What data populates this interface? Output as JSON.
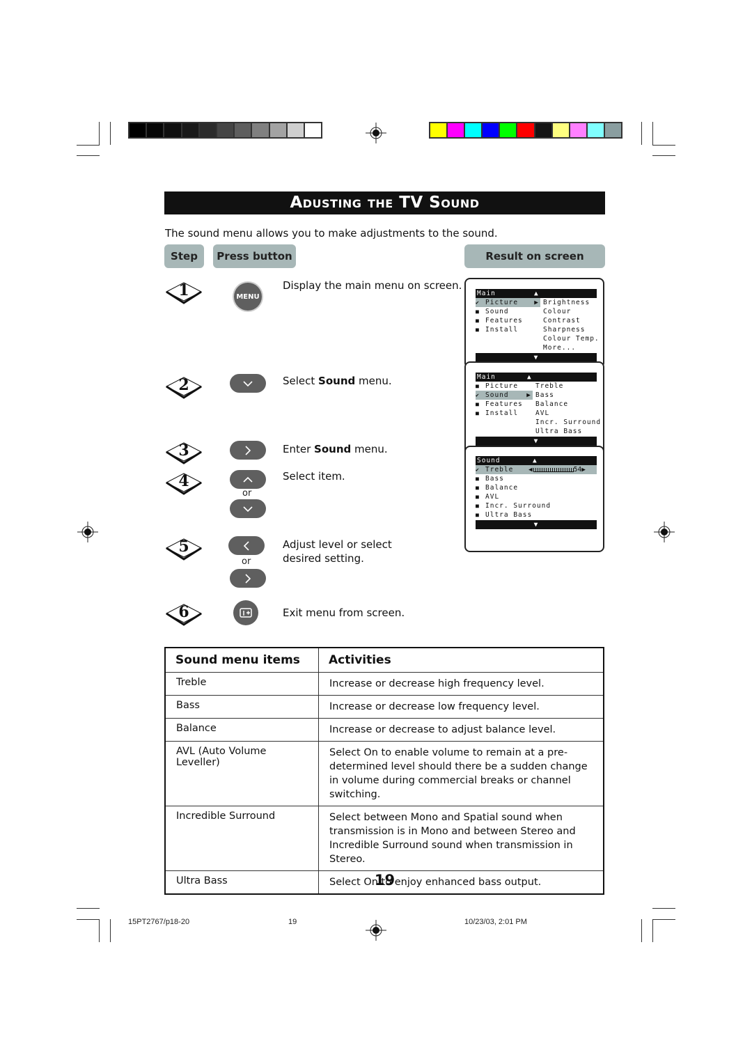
{
  "print_marks": {
    "gray_swatches": [
      "#000000",
      "#060606",
      "#0f0f0f",
      "#191919",
      "#2b2b2b",
      "#454545",
      "#5e5e5e",
      "#808080",
      "#a3a3a3",
      "#cfcfcf",
      "#ffffff"
    ],
    "color_swatches": [
      "#ffff00",
      "#ff00ff",
      "#00ffff",
      "#0000ff",
      "#00ff00",
      "#ff0000",
      "#151515",
      "#ffff80",
      "#ff80ff",
      "#80ffff",
      "#8a9ea0"
    ]
  },
  "title": "Adusting the TV Sound",
  "intro": "The sound menu allows you to make adjustments to the sound.",
  "headers": {
    "step": "Step",
    "press_button": "Press button",
    "result": "Result on screen"
  },
  "steps": [
    {
      "num": "1",
      "button": "MENU",
      "text": "Display the main menu on screen.",
      "icon": "menu-button"
    },
    {
      "num": "2",
      "text_pre": "Select ",
      "text_bold": "Sound",
      "text_post": " menu.",
      "icon": "cursor-down"
    },
    {
      "num": "3",
      "text_pre": "Enter ",
      "text_bold": "Sound",
      "text_post": " menu.",
      "icon": "cursor-right"
    },
    {
      "num": "4",
      "text": "Select item.",
      "icon": "cursor-up-down",
      "or": "or"
    },
    {
      "num": "5",
      "text": "Adjust level or select desired setting.",
      "icon": "cursor-left-right",
      "or": "or"
    },
    {
      "num": "6",
      "text": "Exit menu from screen.",
      "icon": "osd-button"
    }
  ],
  "osd_screens": [
    {
      "header": "Main",
      "up_arrow": "▲",
      "down_arrow": "▼",
      "left_items": [
        {
          "mark": "✔",
          "label": "Picture",
          "selected": true
        },
        {
          "mark": "■",
          "label": "Sound"
        },
        {
          "mark": "■",
          "label": "Features"
        },
        {
          "mark": "■",
          "label": "Install"
        }
      ],
      "right_items": [
        "Brightness",
        "Colour",
        "Contrast",
        "Sharpness",
        "Colour Temp.",
        "More..."
      ]
    },
    {
      "header": "Main",
      "up_arrow": "▲",
      "down_arrow": "▼",
      "left_items": [
        {
          "mark": "■",
          "label": "Picture"
        },
        {
          "mark": "✔",
          "label": "Sound",
          "selected": true
        },
        {
          "mark": "■",
          "label": "Features"
        },
        {
          "mark": "■",
          "label": "Install"
        }
      ],
      "right_items": [
        "Treble",
        "Bass",
        "Balance",
        "AVL",
        "Incr. Surround",
        "Ultra Bass"
      ]
    },
    {
      "header": "Sound",
      "up_arrow": "▲",
      "down_arrow": "▼",
      "items": [
        {
          "mark": "✔",
          "label": "Treble",
          "selected": true,
          "slider_value": "54"
        },
        {
          "mark": "■",
          "label": "Bass"
        },
        {
          "mark": "■",
          "label": "Balance"
        },
        {
          "mark": "■",
          "label": "AVL"
        },
        {
          "mark": "■",
          "label": "Incr. Surround"
        },
        {
          "mark": "■",
          "label": "Ultra Bass"
        }
      ]
    }
  ],
  "table": {
    "headers": [
      "Sound menu items",
      "Activities"
    ],
    "rows": [
      [
        "Treble",
        "Increase or decrease high frequency level."
      ],
      [
        "Bass",
        "Increase or decrease low frequency level."
      ],
      [
        "Balance",
        "Increase or decrease to adjust balance level."
      ],
      [
        "AVL (Auto Volume Leveller)",
        "Select On to enable volume to remain at a pre-determined level should there be a sudden change in volume during commercial breaks or channel switching."
      ],
      [
        "Incredible Surround",
        "Select between Mono and Spatial sound when transmission is in Mono and between Stereo and Incredible Surround sound when transmission in Stereo."
      ],
      [
        "Ultra Bass",
        "Select On to enjoy enhanced bass output."
      ]
    ]
  },
  "page_number": "19",
  "footer": {
    "file": "15PT2767/p18-20",
    "page": "19",
    "date": "10/23/03, 2:01 PM"
  }
}
